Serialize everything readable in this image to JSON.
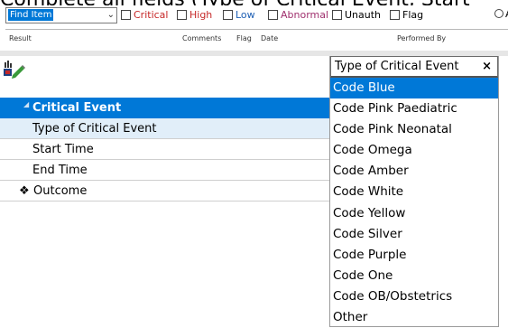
{
  "instruction": "Complete all fields (Type of Critical Event, Start",
  "toolbar": {
    "find_value": "Find Item",
    "filters": [
      {
        "label": "Critical",
        "color": "#c62828"
      },
      {
        "label": "High",
        "color": "#c62828"
      },
      {
        "label": "Low",
        "color": "#1e5fb4"
      },
      {
        "label": "Abnormal",
        "color": "#a0306e"
      },
      {
        "label": "Unauth",
        "color": "#222222"
      },
      {
        "label": "Flag",
        "color": "#222222"
      }
    ],
    "radio_label": "A"
  },
  "columns": [
    "Result",
    "Comments",
    "Flag",
    "Date",
    "Performed By"
  ],
  "tree": {
    "section": "Critical Event",
    "rows": [
      "Type of Critical Event",
      "Start Time",
      "End Time",
      "Outcome"
    ]
  },
  "dropdown": {
    "title": "Type of Critical Event",
    "close": "×",
    "options": [
      "Code Blue",
      "Code Pink Paediatric",
      "Code Pink Neonatal",
      "Code Omega",
      "Code Amber",
      "Code White",
      "Code Yellow",
      "Code Silver",
      "Code Purple",
      "Code One",
      "Code OB/Obstetrics",
      "Other"
    ],
    "highlighted": "Code Blue"
  },
  "colors": {
    "accent": "#0078d7",
    "row_highlight": "#e1eef9"
  }
}
